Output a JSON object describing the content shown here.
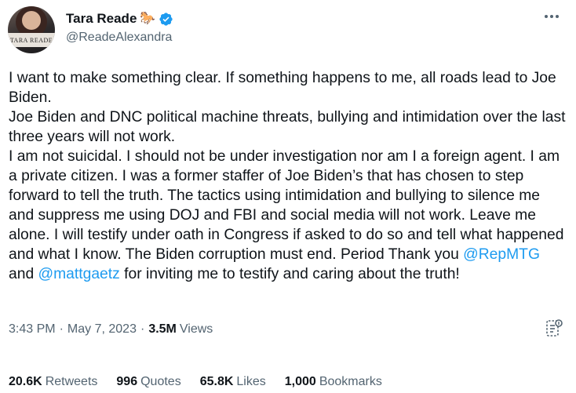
{
  "author": {
    "display_name": "Tara Reade",
    "name_emoji": "🐎",
    "handle": "@ReadeAlexandra",
    "avatar_text": "TARA READE",
    "verified_color": "#1d9bf0"
  },
  "tweet": {
    "text_1": "I want to make something clear. If something happens to me, all roads lead to Joe Biden.\nJoe Biden and DNC political machine threats, bullying and intimidation over the last three years will not work.\nI am not suicidal. I should not be under investigation nor am I a foreign agent. I am a private citizen. I was a former staffer of Joe Biden’s that has chosen to step forward to tell the truth. The tactics using intimidation and bullying to silence me and suppress me using DOJ and FBI and social media will not work. Leave me alone. I will testify under oath in Congress if asked to do so and tell what happened and what I know. The Biden corruption must end. Period Thank you ",
    "mention_1": "@RepMTG",
    "text_2": " and ",
    "mention_2": "@mattgaetz",
    "text_3": " for inviting me to testify and caring about the truth!"
  },
  "meta": {
    "time": "3:43 PM",
    "separator": "·",
    "date": "May 7, 2023",
    "views_count": "3.5M",
    "views_label": "Views"
  },
  "stats": {
    "retweets_count": "20.6K",
    "retweets_label": "Retweets",
    "quotes_count": "996",
    "quotes_label": "Quotes",
    "likes_count": "65.8K",
    "likes_label": "Likes",
    "bookmarks_count": "1,000",
    "bookmarks_label": "Bookmarks"
  },
  "colors": {
    "link": "#1d9bf0",
    "secondary_text": "#536471",
    "primary_text": "#0f1419"
  },
  "icons": [
    "verified-badge-icon",
    "more-options-icon",
    "analytics-icon"
  ]
}
